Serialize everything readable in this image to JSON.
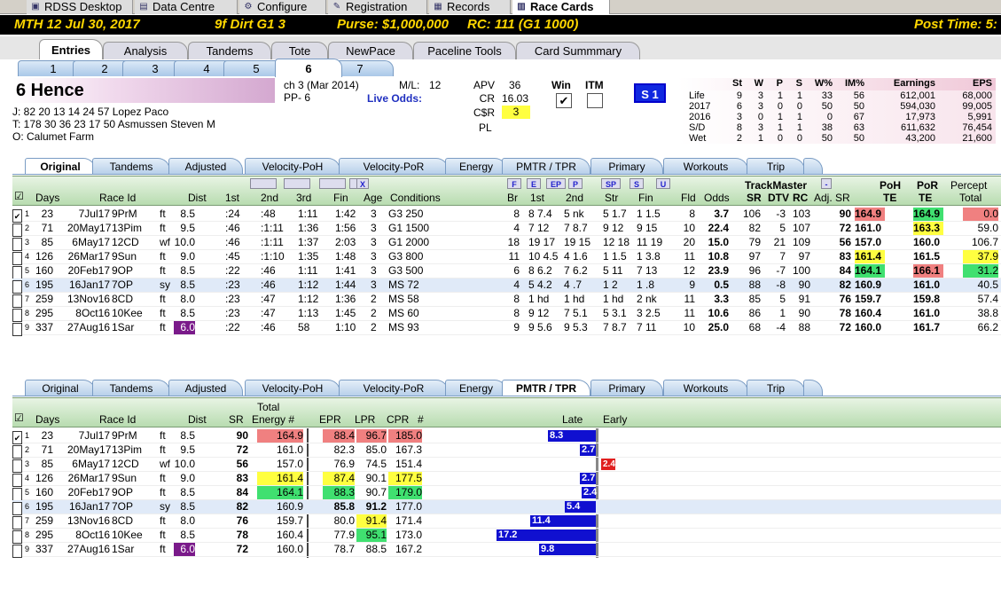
{
  "app_tabs": [
    {
      "label": "RDSS Desktop",
      "icon": "desktop-icon"
    },
    {
      "label": "Data Centre",
      "icon": "database-icon"
    },
    {
      "label": "Configure",
      "icon": "gear-icon"
    },
    {
      "label": "Registration",
      "icon": "registration-icon"
    },
    {
      "label": "Records",
      "icon": "grid-icon"
    },
    {
      "label": "Race Cards",
      "icon": "cards-icon"
    }
  ],
  "race_header": {
    "track": "MTH  12  Jul 30, 2017",
    "cond": "9f  Dirt   G1  3",
    "purse": "Purse: $1,000,000",
    "rc": "RC: 111  (G1 1000)",
    "post": "Post Time: 5:"
  },
  "section_tabs": [
    "Entries",
    "Analysis",
    "Tandems",
    "Tote",
    "NewPace",
    "Paceline Tools",
    "Card Summmary"
  ],
  "runner_tabs": [
    "1",
    "2",
    "3",
    "4",
    "5",
    "6",
    "7"
  ],
  "horse": {
    "number_name": "6  Hence",
    "j_line": "J:  82  20  13  14    24   57   Lopez Paco",
    "t_line": "T:  178  30  36  23    17   50   Asmussen Steven M",
    "o_line": "O:  Calumet Farm",
    "pedigree": "ch  3  (Mar 2014)",
    "pp": "PP- 6",
    "ml_label": "M/L:",
    "ml": "12",
    "live_odds": "Live Odds:",
    "apv_label": "APV",
    "apv": "36",
    "cr_label": "CR",
    "cr": "16.03",
    "csr_label": "C$R",
    "csr": "3",
    "pl_label": "PL",
    "win": "Win",
    "itm": "ITM",
    "s1": "S 1"
  },
  "stats": {
    "headers": [
      "St",
      "W",
      "P",
      "S",
      "W%",
      "IM%",
      "Earnings",
      "EPS"
    ],
    "rows": [
      [
        "Life",
        "9",
        "3",
        "1",
        "1",
        "33",
        "56",
        "612,001",
        "68,000"
      ],
      [
        "2017",
        "6",
        "3",
        "0",
        "0",
        "50",
        "50",
        "594,030",
        "99,005"
      ],
      [
        "2016",
        "3",
        "0",
        "1",
        "1",
        "0",
        "67",
        "17,973",
        "5,991"
      ],
      [
        "S/D",
        "8",
        "3",
        "1",
        "1",
        "38",
        "63",
        "611,632",
        "76,454"
      ],
      [
        "Wet",
        "2",
        "1",
        "0",
        "0",
        "50",
        "50",
        "43,200",
        "21,600"
      ]
    ]
  },
  "grid_tabs": [
    "Original",
    "Tandems",
    "Adjusted",
    "Velocity-PoH",
    "Velocity-PoR",
    "Energy",
    "PMTR / TPR",
    "Primary",
    "Workouts",
    "Trip"
  ],
  "top_grid": {
    "headers": [
      "Days",
      "Race Id",
      "Dist",
      "1st",
      "2nd",
      "3rd",
      "Fin",
      "Age",
      "Conditions",
      "Br",
      "1st",
      "2nd",
      "Str",
      "Fin",
      "Fld",
      "Odds",
      "TrackMaster",
      "SR",
      "DTV",
      "RC",
      "Adj. SR",
      "PoH",
      "TE",
      "PoR",
      "TE",
      "Percept",
      "Total"
    ],
    "buttons": [
      "F",
      "E",
      "EP",
      "P",
      "SP",
      "S",
      "U",
      "X"
    ],
    "rows": [
      [
        "1",
        "23",
        "7Jul17",
        "9PrM",
        "ft",
        "8.5",
        ":24",
        ":48",
        "1:11",
        "1:42",
        "3",
        "G3 250",
        "8",
        "8 7.4",
        "5 nk",
        "5 1.7",
        "1 1.5",
        "8",
        "3.7",
        "106",
        "-3",
        "103",
        "90",
        "164.9",
        "164.9",
        "0.0"
      ],
      [
        "2",
        "71",
        "20May17",
        "13Pim",
        "ft",
        "9.5",
        ":46",
        ":1:11",
        "1:36",
        "1:56",
        "3",
        "G1 1500",
        "4",
        "7 12",
        "7 8.7",
        "9 12",
        "9 15",
        "10",
        "22.4",
        "82",
        "5",
        "107",
        "72",
        "161.0",
        "163.3",
        "59.0"
      ],
      [
        "3",
        "85",
        "6May17",
        "12CD",
        "wf",
        "10.0",
        ":46",
        ":1:11",
        "1:37",
        "2:03",
        "3",
        "G1 2000",
        "18",
        "19 17",
        "19 15",
        "12 18",
        "11 19",
        "20",
        "15.0",
        "79",
        "21",
        "109",
        "56",
        "157.0",
        "160.0",
        "106.7"
      ],
      [
        "4",
        "126",
        "26Mar17",
        "9Sun",
        "ft",
        "9.0",
        ":45",
        ":1:10",
        "1:35",
        "1:48",
        "3",
        "G3 800",
        "11",
        "10 4.5",
        "4 1.6",
        "1 1.5",
        "1 3.8",
        "11",
        "10.8",
        "97",
        "7",
        "97",
        "83",
        "161.4",
        "161.5",
        "37.9"
      ],
      [
        "5",
        "160",
        "20Feb17",
        "9OP",
        "ft",
        "8.5",
        ":22",
        ":46",
        "1:11",
        "1:41",
        "3",
        "G3 500",
        "6",
        "8 6.2",
        "7 6.2",
        "5 11",
        "7 13",
        "12",
        "23.9",
        "96",
        "-7",
        "100",
        "84",
        "164.1",
        "166.1",
        "31.2"
      ],
      [
        "6",
        "195",
        "16Jan17",
        "7OP",
        "sy",
        "8.5",
        ":23",
        ":46",
        "1:12",
        "1:44",
        "3",
        "MS 72",
        "4",
        "5 4.2",
        "4 .7",
        "1 2",
        "1 .8",
        "9",
        "0.5",
        "88",
        "-8",
        "90",
        "82",
        "160.9",
        "161.0",
        "40.5"
      ],
      [
        "7",
        "259",
        "13Nov16",
        "8CD",
        "ft",
        "8.0",
        ":23",
        ":47",
        "1:12",
        "1:36",
        "2",
        "MS 58",
        "8",
        "1 hd",
        "1 hd",
        "1 hd",
        "2 nk",
        "11",
        "3.3",
        "85",
        "5",
        "91",
        "76",
        "159.7",
        "159.8",
        "57.4"
      ],
      [
        "8",
        "295",
        "8Oct16",
        "10Kee",
        "ft",
        "8.5",
        ":23",
        ":47",
        "1:13",
        "1:45",
        "2",
        "MS 60",
        "8",
        "9 12",
        "7 5.1",
        "5 3.1",
        "3 2.5",
        "11",
        "10.6",
        "86",
        "1",
        "90",
        "78",
        "160.4",
        "161.0",
        "38.8"
      ],
      [
        "9",
        "337",
        "27Aug16",
        "1Sar",
        "ft",
        "6.0",
        ":22",
        ":46",
        "58",
        "1:10",
        "2",
        "MS 93",
        "9",
        "9 5.6",
        "9 5.3",
        "7 8.7",
        "7 11",
        "10",
        "25.0",
        "68",
        "-4",
        "88",
        "72",
        "160.0",
        "161.7",
        "66.2"
      ]
    ]
  },
  "bottom_grid": {
    "headers": [
      "Days",
      "Race Id",
      "Dist",
      "SR",
      "Total",
      "Energy #",
      "EPR",
      "LPR",
      "CPR",
      "#",
      "Late",
      "Early"
    ],
    "rows": [
      [
        "1",
        "23",
        "7Jul17",
        "9PrM",
        "ft",
        "8.5",
        "90",
        "164.9",
        "88.4",
        "96.7",
        "185.0",
        "8.3"
      ],
      [
        "2",
        "71",
        "20May17",
        "13Pim",
        "ft",
        "9.5",
        "72",
        "161.0",
        "82.3",
        "85.0",
        "167.3",
        "2.7"
      ],
      [
        "3",
        "85",
        "6May17",
        "12CD",
        "wf",
        "10.0",
        "56",
        "157.0",
        "76.9",
        "74.5",
        "151.4",
        "2.4"
      ],
      [
        "4",
        "126",
        "26Mar17",
        "9Sun",
        "ft",
        "9.0",
        "83",
        "161.4",
        "87.4",
        "90.1",
        "177.5",
        "2.7"
      ],
      [
        "5",
        "160",
        "20Feb17",
        "9OP",
        "ft",
        "8.5",
        "84",
        "164.1",
        "88.3",
        "90.7",
        "179.0",
        "2.4"
      ],
      [
        "6",
        "195",
        "16Jan17",
        "7OP",
        "sy",
        "8.5",
        "82",
        "160.9",
        "85.8",
        "91.2",
        "177.0",
        "5.4"
      ],
      [
        "7",
        "259",
        "13Nov16",
        "8CD",
        "ft",
        "8.0",
        "76",
        "159.7",
        "80.0",
        "91.4",
        "171.4",
        "11.4"
      ],
      [
        "8",
        "295",
        "8Oct16",
        "10Kee",
        "ft",
        "8.5",
        "78",
        "160.4",
        "77.9",
        "95.1",
        "173.0",
        "17.2"
      ],
      [
        "9",
        "337",
        "27Aug16",
        "1Sar",
        "ft",
        "6.0",
        "72",
        "160.0",
        "78.7",
        "88.5",
        "167.2",
        "9.8"
      ]
    ]
  }
}
